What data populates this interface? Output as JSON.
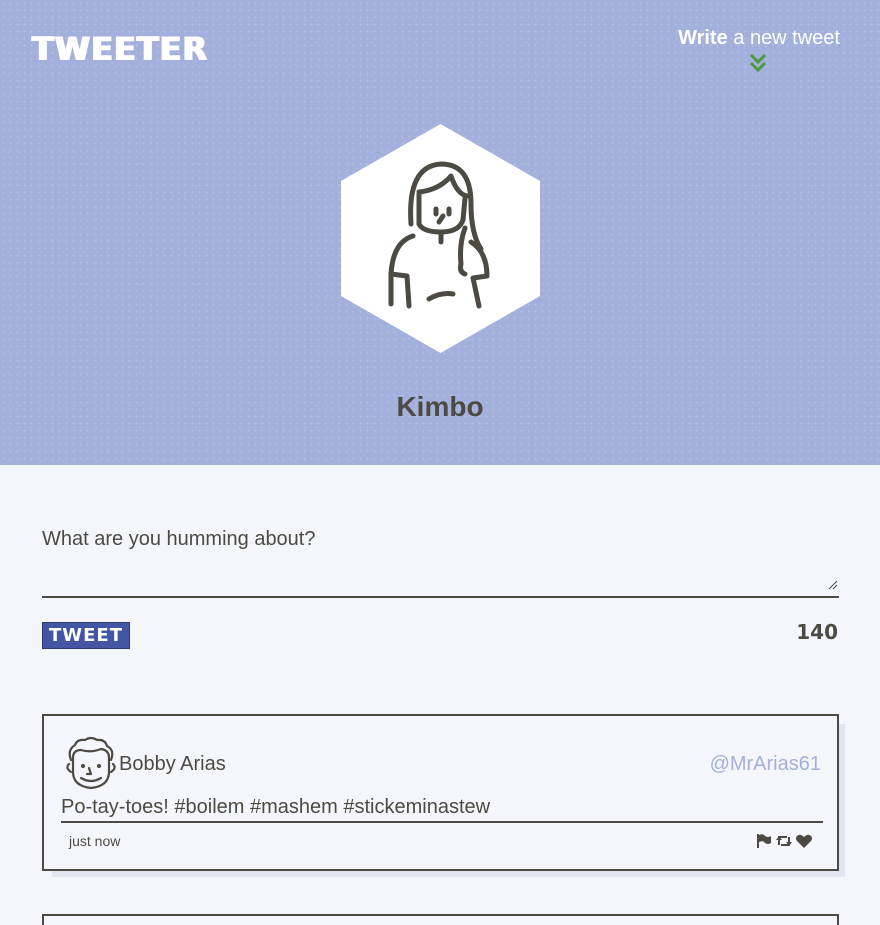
{
  "header": {
    "logo": "TWEETER",
    "write_bold": "Write",
    "write_rest": " a new tweet"
  },
  "profile": {
    "name": "Kimbo"
  },
  "compose": {
    "label": "What are you humming about?",
    "button_label": "TWEET",
    "char_count": "140"
  },
  "tweets": [
    {
      "name": "Bobby Arias",
      "handle": "@MrArias61",
      "body": "Po-tay-toes! #boilem #mashem #stickeminastew",
      "time": "just now"
    }
  ],
  "colors": {
    "hero_bg": "#a3b0dc",
    "page_bg": "#f5f6fb",
    "text": "#4c4a43",
    "button_bg": "#4355a3",
    "chevron": "#4b9a3f",
    "handle": "#a3b0dc"
  }
}
